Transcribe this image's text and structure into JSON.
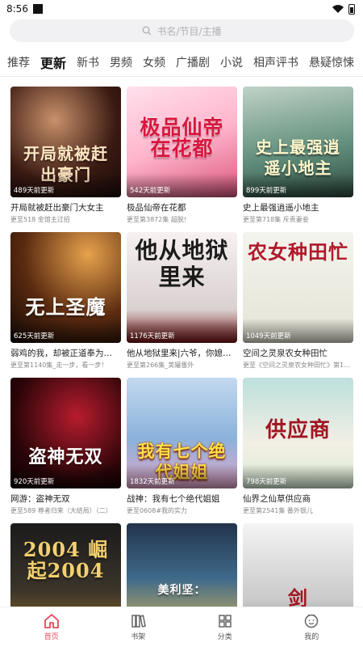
{
  "status": {
    "time": "8:56"
  },
  "search": {
    "placeholder": "书名/节目/主播"
  },
  "tabs": [
    {
      "label": "推荐"
    },
    {
      "label": "更新"
    },
    {
      "label": "新书"
    },
    {
      "label": "男频"
    },
    {
      "label": "女频"
    },
    {
      "label": "广播剧"
    },
    {
      "label": "小说"
    },
    {
      "label": "相声评书"
    },
    {
      "label": "悬疑惊悚"
    }
  ],
  "books": [
    {
      "cover_text": "开局就被赶出豪门",
      "updated": "489天前更新",
      "title": "开局就被赶出豪门大女主",
      "subtitle": "更至518 金馆主过招"
    },
    {
      "cover_text": "极品仙帝在花都",
      "updated": "542天前更新",
      "title": "极品仙帝在花都",
      "subtitle": "更至第3872集 超脱!"
    },
    {
      "cover_text": "史上最强逍遥小地主",
      "updated": "899天前更新",
      "title": "史上最强逍遥小地主",
      "subtitle": "更至第718集 斥责妻妾"
    },
    {
      "cover_text": "无上圣魔",
      "updated": "625天前更新",
      "title": "弱鸡的我，却被正道奉为…",
      "subtitle": "更至第1140集_走一步，看一步！"
    },
    {
      "cover_text": "他从地狱里来",
      "updated": "1176天前更新",
      "title": "他从地狱里来|六爷，你媳…",
      "subtitle": "更至第266集_荚罐番外"
    },
    {
      "cover_text": "农女种田忙",
      "updated": "1049天前更新",
      "title": "空间之灵泉农女种田忙",
      "subtitle": "更至《空间之灵泉农女种田忙》第1…"
    },
    {
      "cover_text": "盗神无双",
      "updated": "920天前更新",
      "title": "网游：盗神无双",
      "subtitle": "更至589 尊者归来（大结局）（二）"
    },
    {
      "cover_text": "我有七个绝代姐姐",
      "updated": "1832天前更新",
      "title": "战神：我有七个绝代姐姐",
      "subtitle": "更至0608#我的实力"
    },
    {
      "cover_text": "供应商",
      "updated": "798天前更新",
      "title": "仙界之仙草供应商",
      "subtitle": "更至第2541集 番外银儿"
    },
    {
      "cover_text": "2004 崛起2004",
      "updated": "",
      "title": "",
      "subtitle": ""
    },
    {
      "cover_text": "美利坚：",
      "updated": "",
      "title": "",
      "subtitle": ""
    },
    {
      "cover_text": "剑",
      "updated": "",
      "title": "",
      "subtitle": ""
    }
  ],
  "bottom_nav": [
    {
      "label": "首页",
      "icon": "home-icon"
    },
    {
      "label": "书架",
      "icon": "bookshelf-icon"
    },
    {
      "label": "分类",
      "icon": "category-icon"
    },
    {
      "label": "我的",
      "icon": "profile-icon"
    }
  ],
  "colors": {
    "accent": "#f0465a"
  }
}
